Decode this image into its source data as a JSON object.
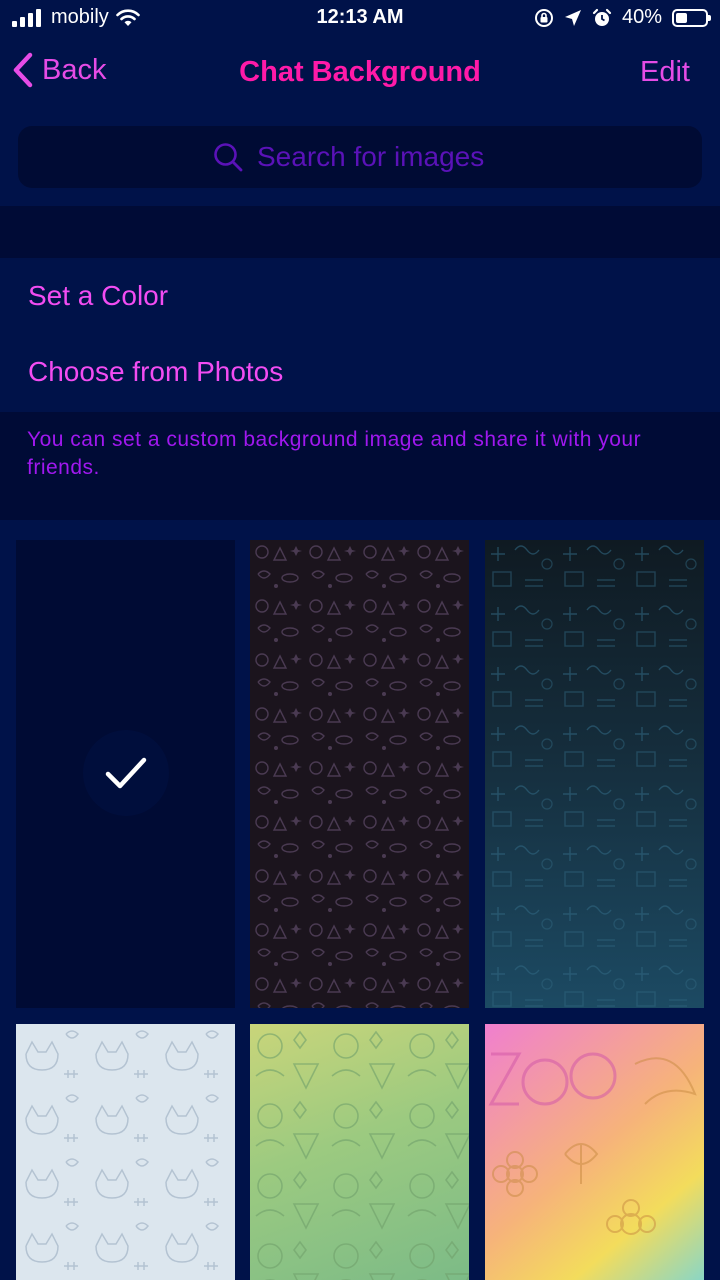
{
  "status_bar": {
    "carrier": "mobily",
    "time": "12:13 AM",
    "battery": "40%",
    "battery_level": 0.4,
    "icons": [
      "signal-icon",
      "wifi-icon",
      "orientation-lock-icon",
      "location-icon",
      "alarm-icon",
      "battery-icon"
    ]
  },
  "nav": {
    "back_label": "Back",
    "title": "Chat Background",
    "edit_label": "Edit"
  },
  "search": {
    "placeholder": "Search for images"
  },
  "options": {
    "set_color": "Set a Color",
    "choose_photos": "Choose from Photos"
  },
  "footer_note": "You can set a custom background image and share it with your friends.",
  "wallpapers": [
    {
      "name": "solid-dark-navy",
      "selected": true
    },
    {
      "name": "dark-doodle-pattern",
      "selected": false
    },
    {
      "name": "math-formulas-pattern",
      "selected": false
    },
    {
      "name": "light-cats-pattern",
      "selected": false
    },
    {
      "name": "green-doodle-pattern",
      "selected": false
    },
    {
      "name": "zoo-gradient-pattern",
      "selected": false
    }
  ],
  "colors": {
    "background": "#001249",
    "accent": "#e64ce6",
    "title": "#ff1aa8",
    "note": "#a018ef"
  }
}
